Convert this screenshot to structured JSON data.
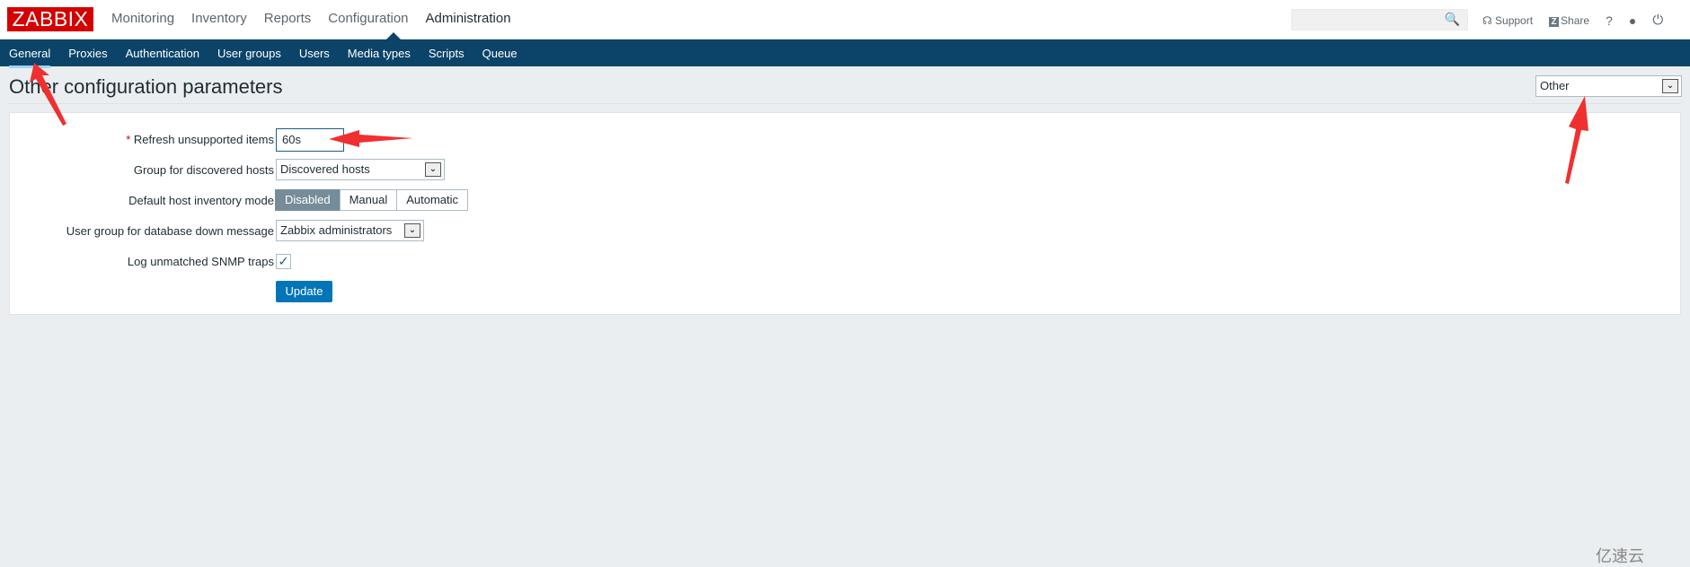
{
  "header": {
    "logo": "ZABBIX",
    "menu": [
      "Monitoring",
      "Inventory",
      "Reports",
      "Configuration",
      "Administration"
    ],
    "active_menu": "Administration",
    "search_placeholder": "",
    "support": "Support",
    "share": "Share",
    "help": "?"
  },
  "submenu": {
    "items": [
      "General",
      "Proxies",
      "Authentication",
      "User groups",
      "Users",
      "Media types",
      "Scripts",
      "Queue"
    ],
    "active": "General"
  },
  "page": {
    "title": "Other configuration parameters",
    "view_select": "Other"
  },
  "form": {
    "refresh_label": "Refresh unsupported items",
    "refresh_value": "60s",
    "group_label": "Group for discovered hosts",
    "group_value": "Discovered hosts",
    "inventory_label": "Default host inventory mode",
    "inventory_options": [
      "Disabled",
      "Manual",
      "Automatic"
    ],
    "inventory_selected": "Disabled",
    "usergroup_label": "User group for database down message",
    "usergroup_value": "Zabbix administrators",
    "snmp_label": "Log unmatched SNMP traps",
    "snmp_checked": true,
    "update": "Update"
  },
  "watermark": "亿速云",
  "colors": {
    "logo": "#d40000",
    "nav": "#0b4468",
    "button": "#0275b8",
    "annotation": "#f03030"
  }
}
